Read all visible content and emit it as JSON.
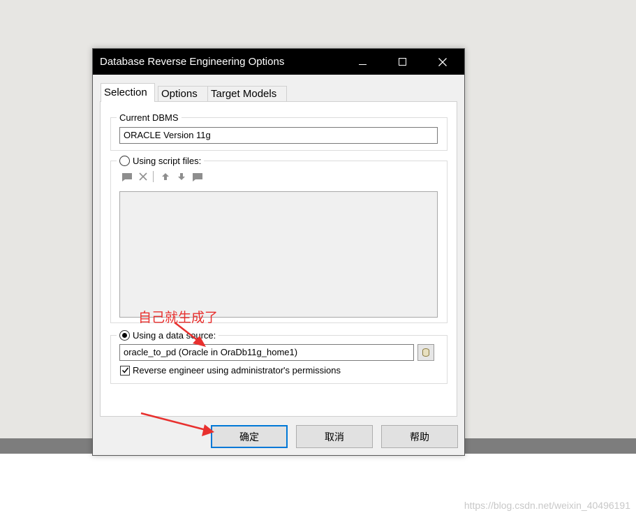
{
  "window": {
    "title": "Database Reverse Engineering Options"
  },
  "tabs": [
    {
      "label": "Selection",
      "active": true
    },
    {
      "label": "Options",
      "active": false
    },
    {
      "label": "Target Models",
      "active": false
    }
  ],
  "current_dbms": {
    "legend": "Current DBMS",
    "value": "ORACLE Version 11g"
  },
  "script_files": {
    "label": "Using script files:",
    "selected": false,
    "toolbar_icons": [
      "add-file-icon",
      "delete-icon",
      "move-up-icon",
      "move-down-icon",
      "edit-file-icon"
    ]
  },
  "data_source": {
    "label": "Using a data source:",
    "selected": true,
    "value": "oracle_to_pd (Oracle in OraDb11g_home1)",
    "browse_icon": "database-icon",
    "admin_checkbox_label": "Reverse engineer using administrator's permissions",
    "admin_checked": true
  },
  "buttons": {
    "ok": "确定",
    "cancel": "取消",
    "help": "帮助"
  },
  "annotation": {
    "text": "自己就生成了",
    "color": "#e8302e"
  },
  "watermark": "https://blog.csdn.net/weixin_40496191",
  "colors": {
    "titlebar": "#000000",
    "default_button_border": "#0078d7"
  }
}
